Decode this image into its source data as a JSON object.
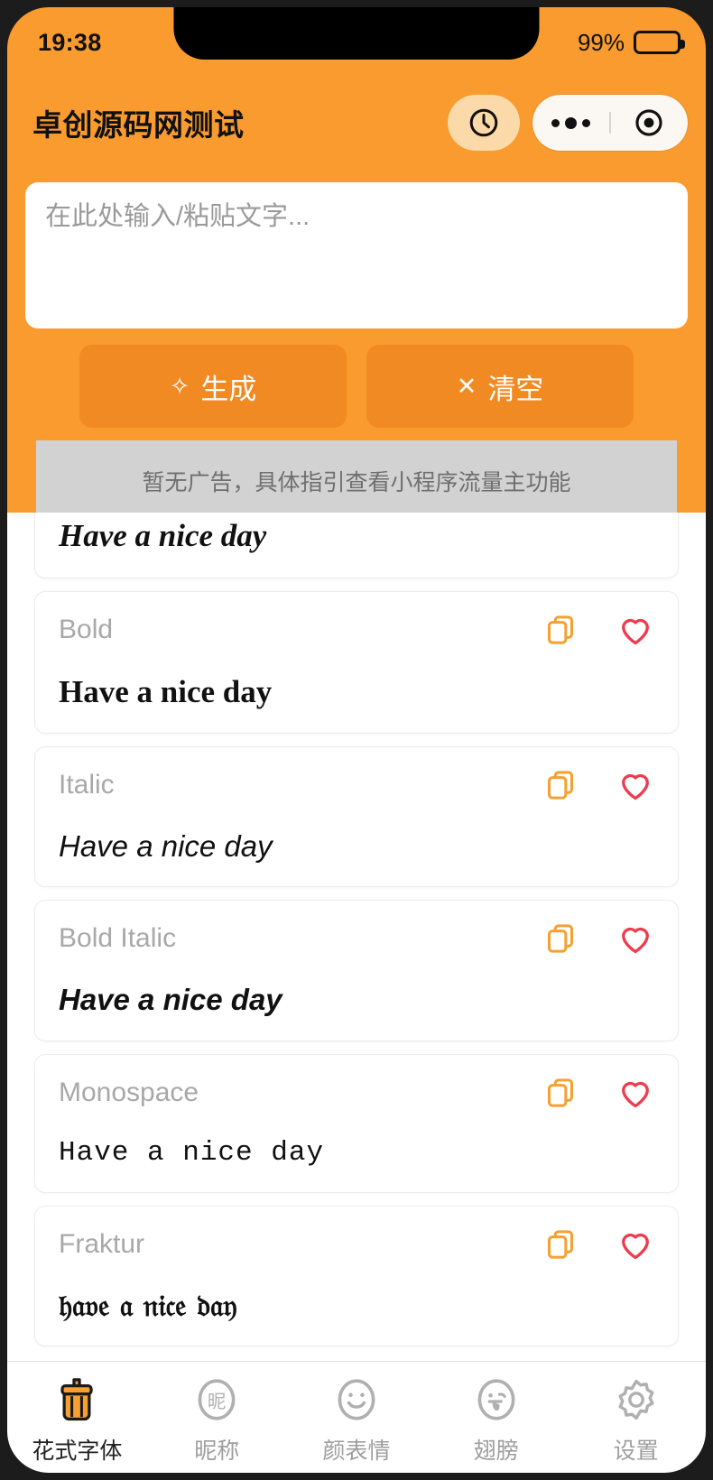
{
  "status_bar": {
    "time": "19:38",
    "battery_percent": "99%"
  },
  "header": {
    "title": "卓创源码网测试",
    "clock_icon": "clock-icon",
    "capsule_more_icon": "more-dots-icon",
    "capsule_target_icon": "target-circle-icon"
  },
  "input": {
    "placeholder": "在此处输入/粘贴文字...",
    "value": ""
  },
  "buttons": {
    "generate": {
      "label": "生成",
      "glyph": "✧"
    },
    "clear": {
      "label": "清空",
      "glyph": "✕"
    }
  },
  "ad": {
    "text": "暂无广告，具体指引查看小程序流量主功能"
  },
  "list": {
    "copy_icon": "copy-icon",
    "favorite_icon": "heart-icon",
    "items": [
      {
        "label": "",
        "sample": "Have a nice day",
        "style": "s-serif-bolditalic",
        "partial": true
      },
      {
        "label": "Bold",
        "sample": "Have a nice day",
        "style": "s-bold"
      },
      {
        "label": "Italic",
        "sample": "Have a nice day",
        "style": "s-italic"
      },
      {
        "label": "Bold Italic",
        "sample": "Have a nice day",
        "style": "s-bolditalic"
      },
      {
        "label": "Monospace",
        "sample": "Have a nice day",
        "style": "s-mono"
      },
      {
        "label": "Fraktur",
        "sample": "𝔥𝔞𝔳𝔢 𝔞 𝔫𝔦𝔠𝔢 𝔡𝔞𝔶",
        "style": "s-fraktur"
      }
    ]
  },
  "tab_bar": {
    "items": [
      {
        "label": "花式字体",
        "icon": "brush-icon",
        "active": true
      },
      {
        "label": "昵称",
        "icon": "nickname-circle-icon",
        "active": false
      },
      {
        "label": "颜表情",
        "icon": "smiley-face-icon",
        "active": false
      },
      {
        "label": "翅膀",
        "icon": "wink-tongue-face-icon",
        "active": false
      },
      {
        "label": "设置",
        "icon": "gear-icon",
        "active": false
      }
    ]
  },
  "colors": {
    "brand_orange": "#f99b2e",
    "button_orange": "#f18a22",
    "copy_icon": "#f5a030",
    "heart_icon": "#ef3b4e",
    "ad_background": "#d2d2d2"
  }
}
